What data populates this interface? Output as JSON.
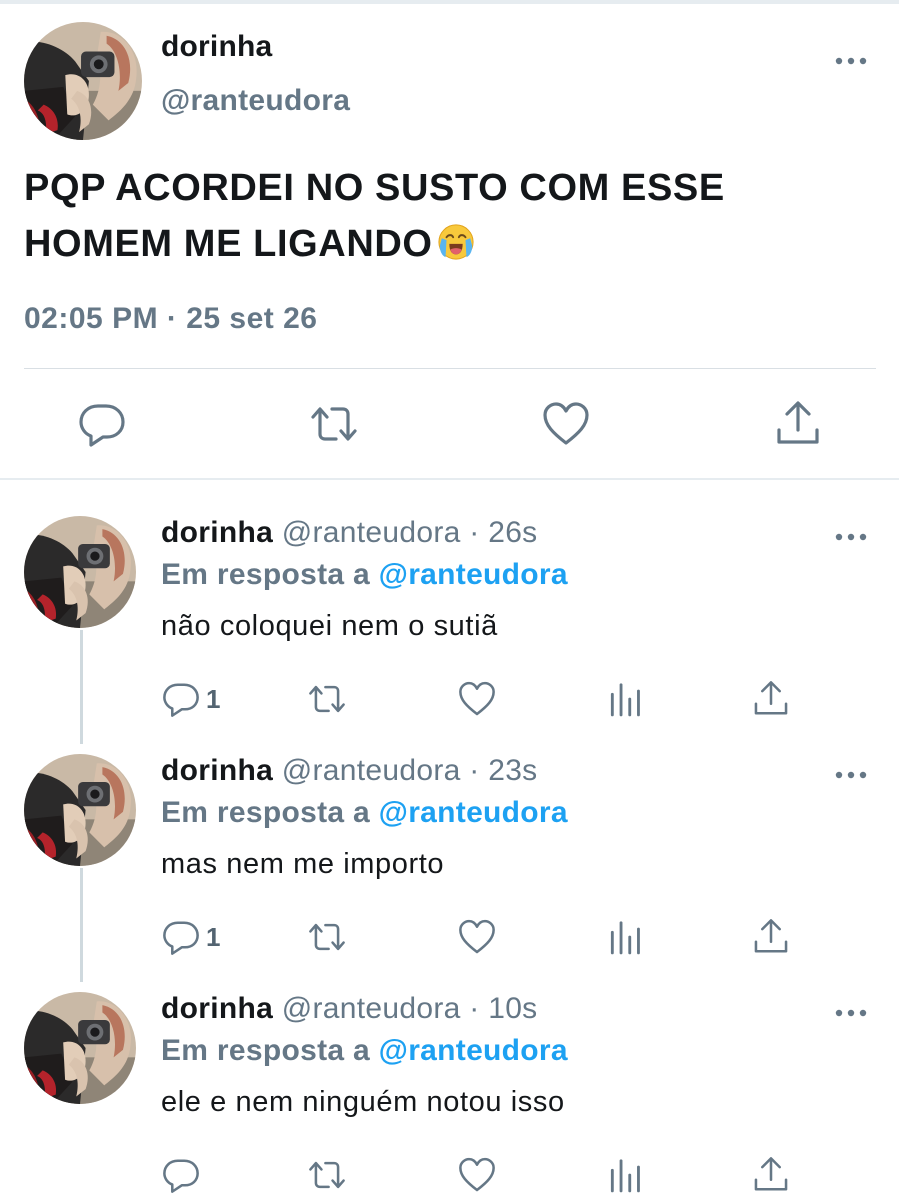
{
  "main_tweet": {
    "display_name": "dorinha",
    "handle": "@ranteudora",
    "text": "PQP ACORDEI NO SUSTO COM ESSE HOMEM ME LIGANDO",
    "emoji": "loudly-crying-face",
    "timestamp": "02:05 PM · 25 set 26",
    "actions": [
      "reply-icon",
      "retweet-icon",
      "like-icon",
      "share-icon"
    ]
  },
  "replies": [
    {
      "display_name": "dorinha",
      "handle": "@ranteudora",
      "separator": "·",
      "time": "26s",
      "in_reply_prefix": "Em resposta a",
      "in_reply_target": "@ranteudora",
      "text": "não coloquei nem o sutiã",
      "reply_count": "1"
    },
    {
      "display_name": "dorinha",
      "handle": "@ranteudora",
      "separator": "·",
      "time": "23s",
      "in_reply_prefix": "Em resposta a",
      "in_reply_target": "@ranteudora",
      "text": "mas nem me importo",
      "reply_count": "1"
    },
    {
      "display_name": "dorinha",
      "handle": "@ranteudora",
      "separator": "·",
      "time": "10s",
      "in_reply_prefix": "Em resposta a",
      "in_reply_target": "@ranteudora",
      "text": "ele e nem ninguém notou isso",
      "reply_count": ""
    }
  ],
  "colors": {
    "text": "#14171a",
    "secondary": "#657786",
    "link": "#1da1f2",
    "divider": "#e6ecf0"
  }
}
